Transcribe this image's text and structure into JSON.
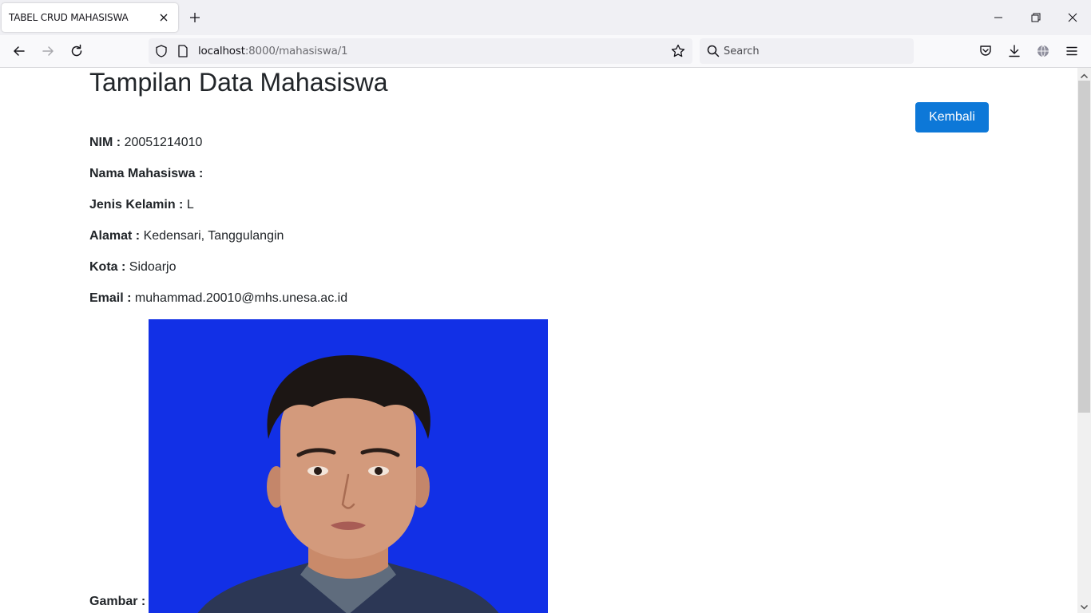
{
  "tab": {
    "title": "TABEL CRUD MAHASISWA"
  },
  "urlbar": {
    "host": "localhost",
    "path": ":8000/mahasiswa/1"
  },
  "search": {
    "placeholder": "Search"
  },
  "page": {
    "title": "Tampilan Data Mahasiswa",
    "back_label": "Kembali",
    "fields": [
      {
        "label": "NIM :",
        "value": "20051214010"
      },
      {
        "label": "Nama Mahasiswa :",
        "value": ""
      },
      {
        "label": "Jenis Kelamin :",
        "value": "L"
      },
      {
        "label": "Alamat :",
        "value": "Kedensari, Tanggulangin"
      },
      {
        "label": "Kota :",
        "value": "Sidoarjo"
      },
      {
        "label": "Email :",
        "value": "muhammad.20010@mhs.unesa.ac.id"
      }
    ],
    "image_label": "Gambar :"
  },
  "colors": {
    "accent": "#0d78d8",
    "photo_background": "#1230e6"
  }
}
